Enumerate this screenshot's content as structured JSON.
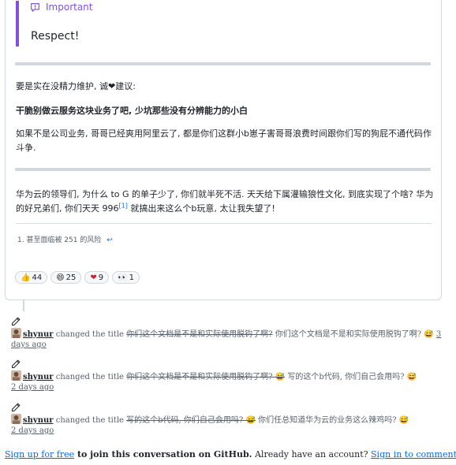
{
  "comment": {
    "alert": {
      "title": "Important",
      "body": "Respect!",
      "accent": "#8250df"
    },
    "paragraphs": {
      "p1_text": "要是实在没精力维护, 诚",
      "p1_heart": "❤",
      "p1_tail": "建议:",
      "p2": "干脆别做云服务这块业务了吧, 少坑那些没有分辨能力的小白",
      "p3": "如果不是公司业务, 哥哥已经爽用阿里云了, 都是你们这群小b崽子害哥哥浪费时间跟你们写的狗屁不通代码作斗争.",
      "p5_before": "华为云的领导们, 为什么 to G 的单子少了, 你们就半死不活. 天天给下属灌输狼性文化, 到底实现了个啥? 华为的好兄弟们, 你们天天 996",
      "p5_sup": "[1]",
      "p5_after": " 就搞出来这么个b玩意, 太让我失望了!"
    },
    "footnote": {
      "text": "1. 甚至面临被 251 的风险",
      "back": "↩"
    },
    "reactions": [
      {
        "emoji": "👍",
        "count": "44"
      },
      {
        "emoji": "😄",
        "count": "25"
      },
      {
        "emoji": "❤",
        "count": "9"
      },
      {
        "emoji": "👀",
        "count": "1"
      }
    ]
  },
  "timeline": [
    {
      "author": "shynur",
      "action": "changed the title",
      "old_title": "你们这个文档是不是和实际使用脱钩了啊?",
      "new_title": "你们这个文档是不是和实际使用脱钩了啊? 😅",
      "date": "3 days ago"
    },
    {
      "author": "shynur",
      "action": "changed the title",
      "old_title": "你们这个文档是不是和实际使用脱钩了啊? 😅",
      "new_title": "写的这个b代码, 你们自己会用吗? 😅",
      "date": "2 days ago"
    },
    {
      "author": "shynur",
      "action": "changed the title",
      "old_title": "写的这个b代码, 你们自己会用吗? 😅",
      "new_title": "你们任总知道华为云的业务这么辣鸡吗? 😅",
      "date": "2 days ago"
    }
  ],
  "signup": {
    "signup_link": "Sign up for free",
    "middle": " to join this conversation on GitHub.",
    "question": " Already have an account? ",
    "signin_link": "Sign in to comment"
  }
}
